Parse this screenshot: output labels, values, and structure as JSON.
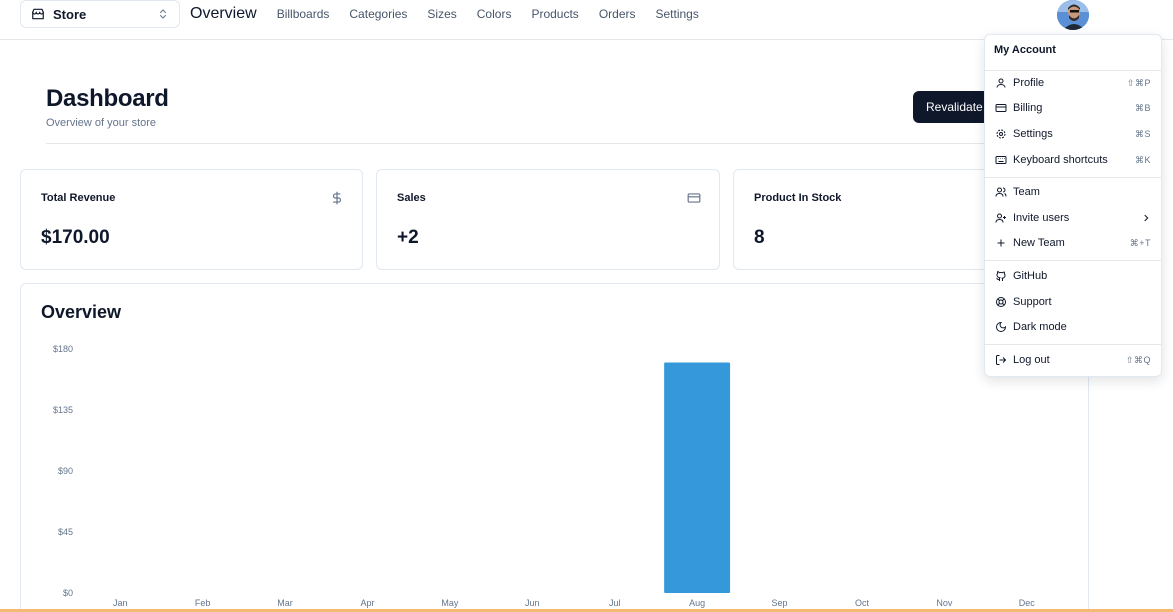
{
  "nav": {
    "store": "Store",
    "links": [
      "Overview",
      "Billboards",
      "Categories",
      "Sizes",
      "Colors",
      "Products",
      "Orders",
      "Settings"
    ]
  },
  "header": {
    "title": "Dashboard",
    "subtitle": "Overview of your store",
    "revalidate_label": "Revalidate"
  },
  "cards": [
    {
      "title": "Total Revenue",
      "value": "$170.00",
      "icon": "dollar-icon"
    },
    {
      "title": "Sales",
      "value": "+2",
      "icon": "credit-card-icon"
    },
    {
      "title": "Product In Stock",
      "value": "8",
      "icon": "package-icon"
    }
  ],
  "chart_data": {
    "type": "bar",
    "title": "Overview",
    "categories": [
      "Jan",
      "Feb",
      "Mar",
      "Apr",
      "May",
      "Jun",
      "Jul",
      "Aug",
      "Sep",
      "Oct",
      "Nov",
      "Dec"
    ],
    "values": [
      0,
      0,
      0,
      0,
      0,
      0,
      0,
      170,
      0,
      0,
      0,
      0
    ],
    "yticks": [
      "$0",
      "$45",
      "$90",
      "$135",
      "$180"
    ],
    "ylim": [
      0,
      180
    ],
    "bar_color": "#3498db"
  },
  "menu": {
    "label": "My Account",
    "groups": [
      [
        {
          "label": "Profile",
          "shortcut": "⇧⌘P",
          "icon": "user-icon"
        },
        {
          "label": "Billing",
          "shortcut": "⌘B",
          "icon": "credit-card-icon"
        },
        {
          "label": "Settings",
          "shortcut": "⌘S",
          "icon": "gear-icon"
        },
        {
          "label": "Keyboard shortcuts",
          "shortcut": "⌘K",
          "icon": "keyboard-icon"
        }
      ],
      [
        {
          "label": "Team",
          "shortcut": "",
          "icon": "users-icon"
        },
        {
          "label": "Invite users",
          "shortcut": "",
          "icon": "user-plus-icon"
        },
        {
          "label": "New Team",
          "shortcut": "⌘+T",
          "icon": "plus-icon"
        }
      ],
      [
        {
          "label": "GitHub",
          "shortcut": "",
          "icon": "github-icon"
        },
        {
          "label": "Support",
          "shortcut": "",
          "icon": "life-buoy-icon"
        },
        {
          "label": "Dark mode",
          "shortcut": "",
          "icon": "moon-icon"
        }
      ],
      [
        {
          "label": "Log out",
          "shortcut": "⇧⌘Q",
          "icon": "log-out-icon"
        }
      ]
    ]
  }
}
